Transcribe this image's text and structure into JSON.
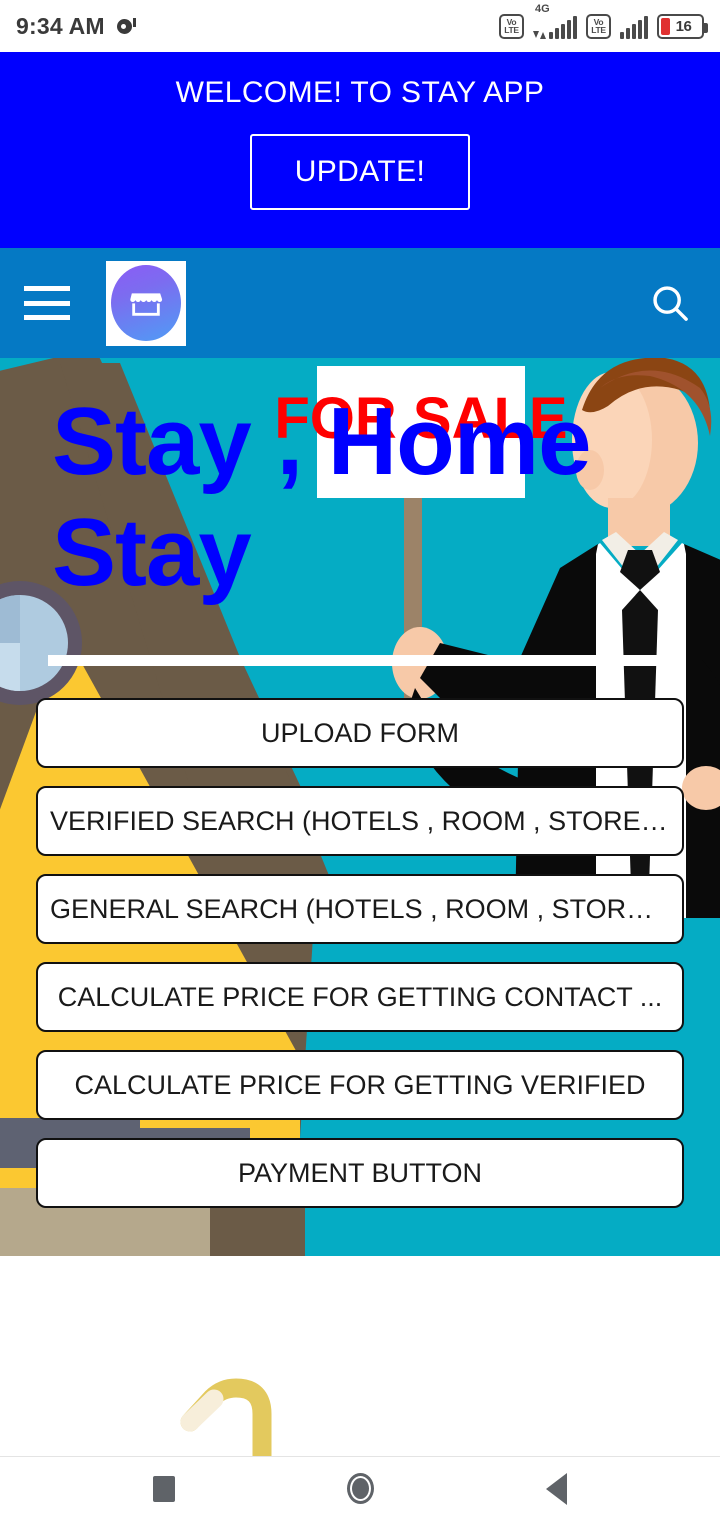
{
  "status_bar": {
    "time": "9:34 AM",
    "notification_icon": "notification-dot-icon",
    "network_label": "4G",
    "volte_label_top": "Vo",
    "volte_label_bottom": "LTE",
    "battery_level": "16"
  },
  "welcome_banner": {
    "title": "WELCOME! TO STAY APP",
    "update_label": "UPDATE!",
    "background_color": "#0000FF",
    "text_color": "#FFFFFF"
  },
  "app_bar": {
    "menu_icon": "hamburger-menu-icon",
    "logo_icon": "storefront-logo-icon",
    "search_icon": "search-icon",
    "background_color": "#0579C4"
  },
  "hero": {
    "headline_line1": "Stay , Home",
    "headline_line2": "Stay",
    "headline_color": "#0000FF",
    "background_color": "#05ACC4",
    "sign_text": "FOR SALE",
    "sign_text_color": "#FF0000"
  },
  "actions": [
    {
      "label": "UPLOAD FORM"
    },
    {
      "label": "VERIFIED SEARCH (HOTELS , ROOM , STORE ..."
    },
    {
      "label": "GENERAL SEARCH (HOTELS , ROOM , STORE ..."
    },
    {
      "label": "CALCULATE PRICE FOR GETTING CONTACT ..."
    },
    {
      "label": "CALCULATE PRICE FOR GETTING VERIFIED"
    },
    {
      "label": "PAYMENT BUTTON"
    }
  ],
  "nav_bar": {
    "recents_icon": "recents-square-icon",
    "home_icon": "home-circle-icon",
    "back_icon": "back-triangle-icon"
  }
}
